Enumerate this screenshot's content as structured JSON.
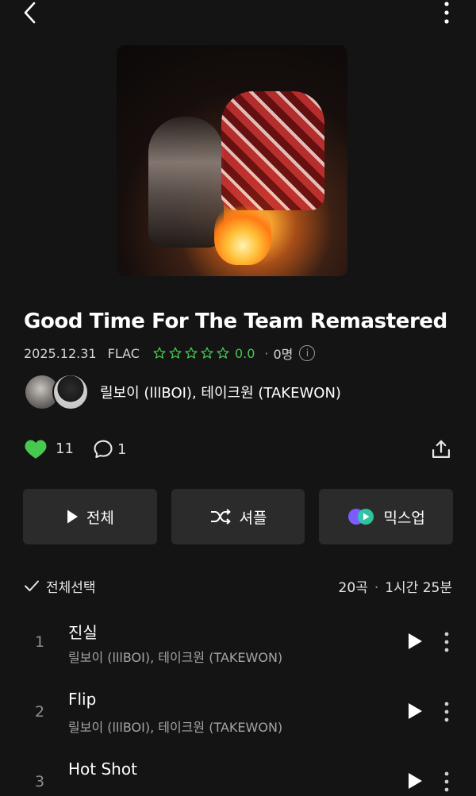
{
  "album": {
    "title": "Good Time For The Team Remastered",
    "date": "2025.12.31",
    "format": "FLAC",
    "rating": "0.0",
    "rating_count": "0명",
    "artists": "릴보이 (lllBOI), 테이크원 (TAKEWON)"
  },
  "actions": {
    "likes": "11",
    "comments": "1"
  },
  "buttons": {
    "play_all": "전체",
    "shuffle": "셔플",
    "mixup": "믹스업"
  },
  "list_header": {
    "select_all": "전체선택",
    "song_count": "20곡",
    "duration": "1시간 25분"
  },
  "tracks": [
    {
      "num": "1",
      "title": "진실",
      "artist": "릴보이 (lllBOI), 테이크원 (TAKEWON)"
    },
    {
      "num": "2",
      "title": "Flip",
      "artist": "릴보이 (lllBOI), 테이크원 (TAKEWON)"
    },
    {
      "num": "3",
      "title": "Hot Shot",
      "artist": ""
    }
  ],
  "colors": {
    "background": "#141414",
    "accent_green": "#47c84f",
    "button_bg": "#2b2b2b"
  },
  "icons": [
    "back-icon",
    "more-vertical-icon",
    "star-outline-icon",
    "info-icon",
    "heart-filled-icon",
    "comment-icon",
    "share-icon",
    "play-icon",
    "shuffle-icon",
    "mixup-icon",
    "checkmark-icon"
  ]
}
